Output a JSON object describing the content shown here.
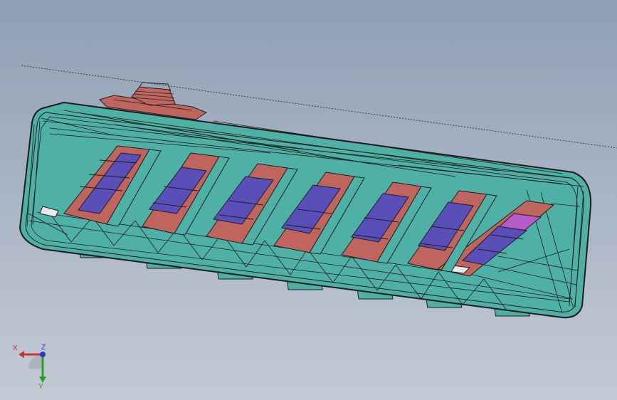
{
  "viewport": {
    "background_top": "#8f9fb3",
    "background_bottom": "#c3cad5",
    "model_name": "",
    "colors": {
      "body": "#4fb0a6",
      "body_edge": "#1d1d1d",
      "slot_red": "#c0645e",
      "slot_blue": "#5a4fb8",
      "slot_magenta": "#b55ac9"
    }
  },
  "triad": {
    "x_label": "X",
    "y_label": "Y",
    "z_label": "Z",
    "x_color": "#d03030",
    "y_color": "#28a028",
    "z_color": "#2838c8"
  }
}
